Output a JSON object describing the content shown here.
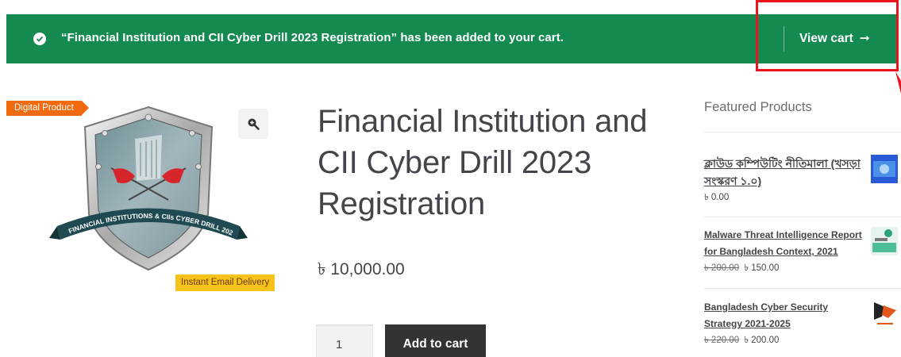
{
  "notice": {
    "message": "“Financial Institution and CII Cyber Drill 2023 Registration” has been added to your cart.",
    "view_cart_label": "View cart",
    "view_cart_arrow": "➞",
    "bg_color": "#148a51"
  },
  "gallery": {
    "badge_digital": "Digital Product",
    "badge_instant": "Instant Email Delivery",
    "logo_text": "FINANCIAL INSTITUTIONS & CIIs CYBER DRILL 2023",
    "zoom_icon": "zoom-in-icon"
  },
  "product": {
    "title": "Financial Institution and CII Cyber Drill 2023 Registration",
    "price": "৳ 10,000.00",
    "quantity": "1",
    "add_to_cart_label": "Add to cart"
  },
  "sidebar": {
    "title": "Featured Products",
    "items": [
      {
        "name": "ক্লাউড কম্পিউটিং নীতিমালা (খসড়া সংস্করণ ১.০)",
        "price": "৳ 0.00",
        "old_price": ""
      },
      {
        "name": "Malware Threat Intelligence Report for Bangladesh Context, 2021",
        "price": "৳ 150.00",
        "old_price": "৳ 200.00"
      },
      {
        "name": "Bangladesh Cyber Security Strategy 2021-2025",
        "price": "৳ 200.00",
        "old_price": "৳ 220.00"
      }
    ]
  }
}
